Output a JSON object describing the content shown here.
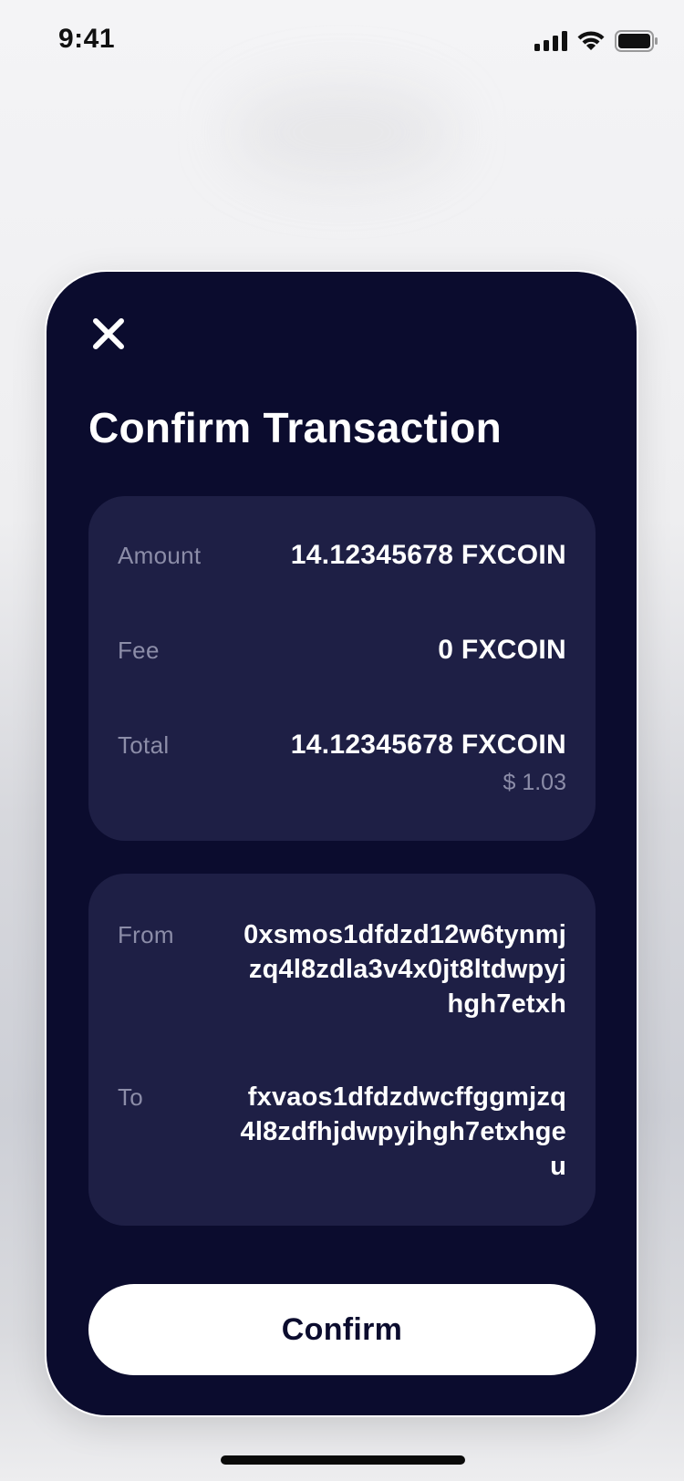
{
  "status_bar": {
    "time": "9:41",
    "icons": [
      "cellular-signal-icon",
      "wifi-icon",
      "battery-icon"
    ]
  },
  "modal": {
    "close_icon": "close-icon",
    "title": "Confirm Transaction",
    "summary": {
      "amount_label": "Amount",
      "amount_value": "14.12345678 FXCOIN",
      "fee_label": "Fee",
      "fee_value": "0 FXCOIN",
      "total_label": "Total",
      "total_value": "14.12345678 FXCOIN",
      "total_fiat": "$ 1.03"
    },
    "addresses": {
      "from_label": "From",
      "from_value": "0xsmos1dfdzd12w6tynmjzq4l8zdla3v4x0jt8ltdwpyjhgh7etxh",
      "to_label": "To",
      "to_value": "fxvaos1dfdzdwcffggmjzq4l8zdfhjdwpyjhgh7etxhgeu"
    },
    "confirm_label": "Confirm"
  },
  "colors": {
    "sheet_background": "#0b0c2e",
    "card_background": "#1e1f45",
    "label_text": "#8c8da8",
    "value_text": "#ffffff",
    "button_background": "#ffffff",
    "button_text": "#0b0c2e"
  }
}
